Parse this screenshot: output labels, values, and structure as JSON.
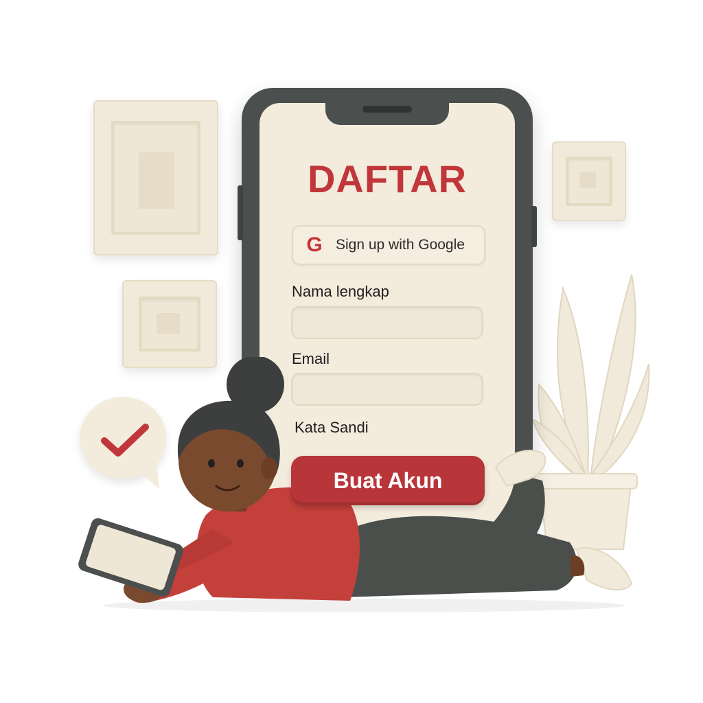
{
  "form": {
    "title": "DAFTAR",
    "google_button_label": "Sign up with Google",
    "google_icon_glyph": "G",
    "fields": [
      {
        "label": "Nama lengkap",
        "value": "",
        "placeholder": ""
      },
      {
        "label": "Email",
        "value": "",
        "placeholder": ""
      },
      {
        "label": "Kata Sandi",
        "value": "",
        "placeholder": ""
      }
    ],
    "submit_label": "Buat Akun"
  },
  "icons": {
    "google": "google-icon",
    "check": "checkmark-icon"
  },
  "colors": {
    "accent": "#c0363a",
    "button": "#b8353a",
    "phone_body": "#4b4f4d",
    "screen": "#f3ecdd",
    "sweater": "#c4403b",
    "pants": "#4a4f4c",
    "cream": "#f1eadb"
  }
}
